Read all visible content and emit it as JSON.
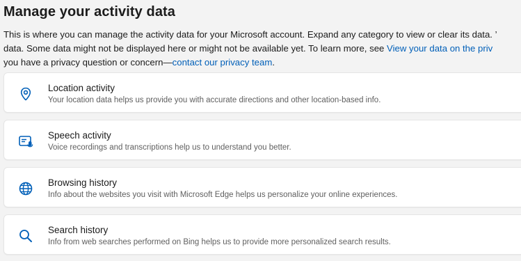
{
  "header": {
    "title": "Manage your activity data"
  },
  "description": {
    "line1": "This is where you can manage the activity data for your Microsoft account. Expand any category to view or clear its data. ’",
    "line2_text": "data. Some data might not be displayed here or might not be available yet. To learn more, see ",
    "line2_link": "View your data on the priv",
    "line3_text": "you have a privacy question or concern—",
    "line3_link": "contact our privacy team",
    "line3_end": "."
  },
  "categories": [
    {
      "icon": "location-pin-icon",
      "title": "Location activity",
      "subtitle": "Your location data helps us provide you with accurate directions and other location-based info."
    },
    {
      "icon": "speech-icon",
      "title": "Speech activity",
      "subtitle": "Voice recordings and transcriptions help us to understand you better."
    },
    {
      "icon": "globe-icon",
      "title": "Browsing history",
      "subtitle": "Info about the websites you visit with Microsoft Edge helps us personalize your online experiences."
    },
    {
      "icon": "search-icon",
      "title": "Search history",
      "subtitle": "Info from web searches performed on Bing helps us to provide more personalized search results."
    }
  ],
  "colors": {
    "accent": "#005fb8",
    "background": "#f3f3f3",
    "card": "#ffffff",
    "secondary_text": "#5f5f5f"
  }
}
